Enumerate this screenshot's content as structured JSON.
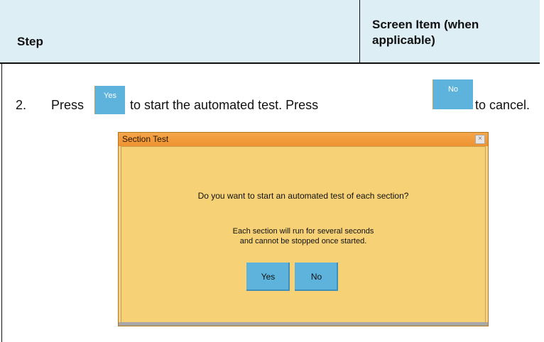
{
  "header": {
    "step_label": "Step",
    "screen_label": "Screen Item (when applicable)"
  },
  "step": {
    "number": "2.",
    "press_1": "Press",
    "yes_btn": "Yes",
    "middle_text": "to start the automated test. Press",
    "no_btn": "No",
    "end_text": "to cancel."
  },
  "dialog": {
    "title": "Section Test",
    "close_glyph": "×",
    "question": "Do you want to start an automated test of each section?",
    "info_line1": "Each section will run for several seconds",
    "info_line2": "and cannot be stopped once started.",
    "yes_label": "Yes",
    "no_label": "No"
  },
  "colors": {
    "header_bg": "#ddeef4",
    "button_blue": "#5db3dc",
    "dialog_bg": "#f6d176",
    "title_orange": "#ee9231"
  }
}
